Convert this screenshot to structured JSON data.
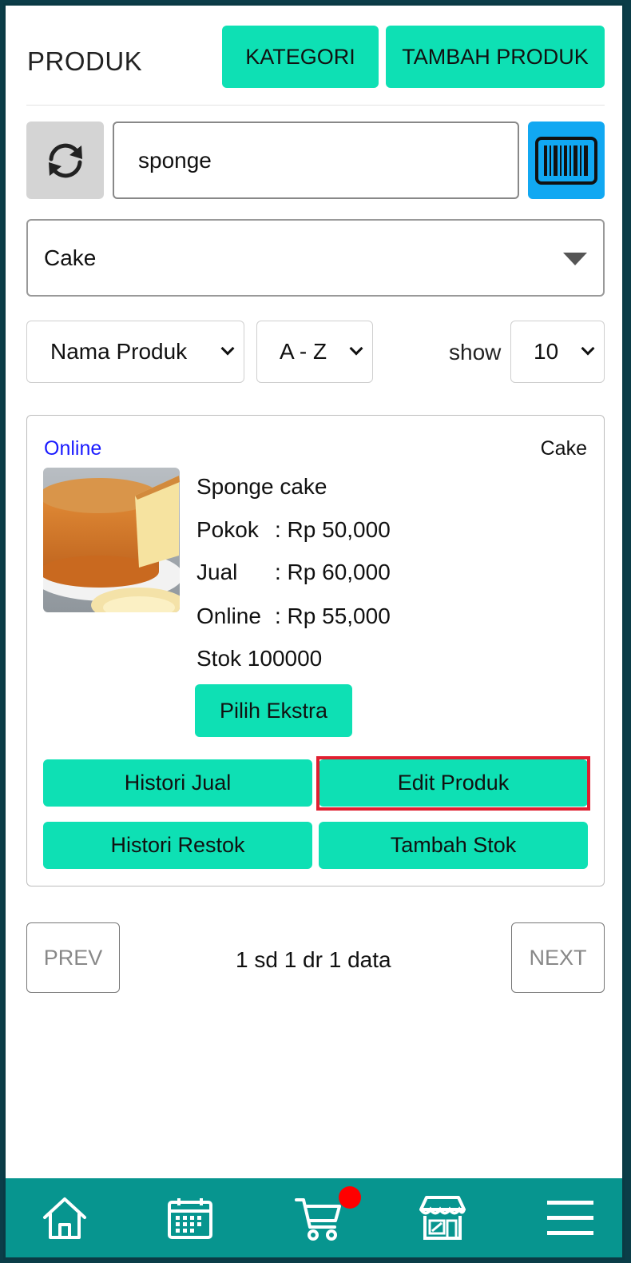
{
  "header": {
    "title": "PRODUK",
    "kategori_label": "KATEGORI",
    "tambah_produk_label": "TAMBAH PRODUK"
  },
  "search": {
    "value": "sponge",
    "refresh_icon": "refresh-icon",
    "barcode_icon": "barcode-icon"
  },
  "filter": {
    "category": "Cake",
    "sort_by": "Nama Produk",
    "order": "A - Z",
    "show_label": "show",
    "show_value": "10"
  },
  "product": {
    "status": "Online",
    "category": "Cake",
    "name": "Sponge cake",
    "pokok_label": "Pokok",
    "pokok_value": ": Rp 50,000",
    "jual_label": "Jual",
    "jual_value": ": Rp 60,000",
    "online_label": "Online",
    "online_value": ": Rp 55,000",
    "stock": "Stok 100000",
    "ekstra_label": "Pilih Ekstra",
    "histori_jual_label": "Histori Jual",
    "edit_label": "Edit Produk",
    "histori_restok_label": "Histori Restok",
    "tambah_stok_label": "Tambah Stok"
  },
  "pagination": {
    "prev_label": "PREV",
    "next_label": "NEXT",
    "info": "1 sd 1 dr 1 data"
  },
  "colors": {
    "accent": "#0ee0b4",
    "barcode_button": "#11a8f2",
    "nav_bar": "#07958f",
    "online_badge": "#1a1aff",
    "highlight": "#e01f30",
    "notification_dot": "#ff0000"
  },
  "nav": {
    "items": [
      "home-icon",
      "calendar-icon",
      "cart-icon",
      "store-icon",
      "menu-icon"
    ]
  }
}
